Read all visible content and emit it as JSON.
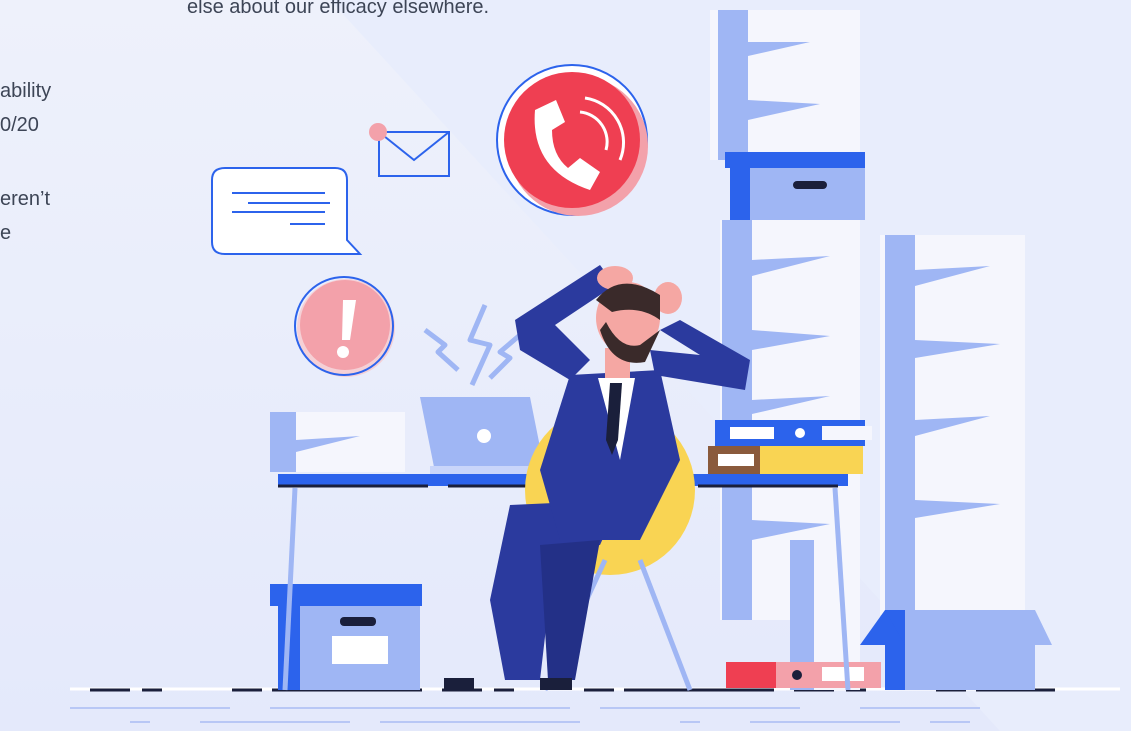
{
  "page": {
    "top_caption": "else about our efficacy elsewhere.",
    "left_fragments": [
      "ability",
      "0/20",
      "eren’t",
      "e"
    ]
  },
  "colors": {
    "navy": "#2b3a9e",
    "blue": "#2c63ec",
    "light_blue": "#9fb6f4",
    "red": "#ef3f52",
    "pink": "#f3a1aa",
    "yellow": "#f9d453",
    "paper": "#f5f6fd",
    "skin": "#f5a7a3",
    "hair": "#3a2a2a"
  },
  "illustration": {
    "icons": [
      "phone-call-icon",
      "envelope-icon",
      "chat-bubble-icon",
      "alert-icon",
      "lightning-icon"
    ]
  }
}
